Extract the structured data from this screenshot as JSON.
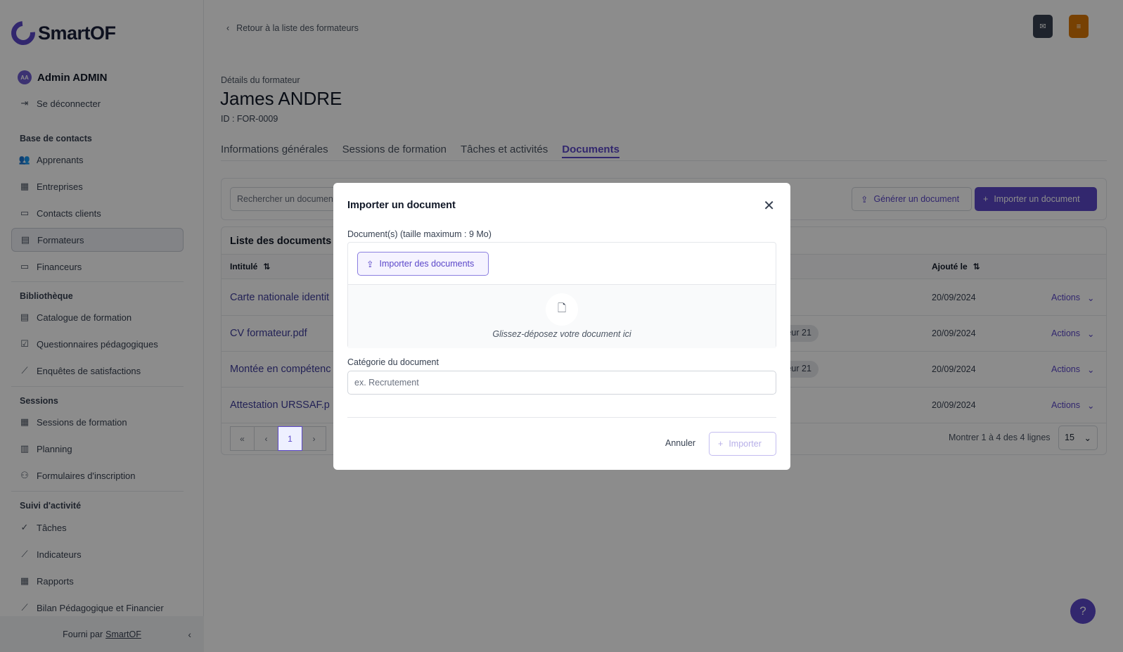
{
  "brand": {
    "name": "SmartOF"
  },
  "user": {
    "initials": "AA",
    "name": "Admin ADMIN",
    "logout": "Se déconnecter"
  },
  "sidebar": {
    "sections": [
      {
        "title": "Base de contacts",
        "items": [
          "Apprenants",
          "Entreprises",
          "Contacts clients",
          "Formateurs",
          "Financeurs"
        ]
      },
      {
        "title": "Bibliothèque",
        "items": [
          "Catalogue de formation",
          "Questionnaires pédagogiques",
          "Enquêtes de satisfactions"
        ]
      },
      {
        "title": "Sessions",
        "items": [
          "Sessions de formation",
          "Planning",
          "Formulaires d'inscription"
        ]
      },
      {
        "title": "Suivi d'activité",
        "items": [
          "Tâches",
          "Indicateurs",
          "Rapports",
          "Bilan Pédagogique et Financier"
        ]
      }
    ],
    "footer": {
      "prefix": "Fourni par",
      "link": "SmartOF"
    }
  },
  "header": {
    "back": "Retour à la liste des formateurs",
    "subtitle": "Détails du formateur",
    "title": "James ANDRE",
    "id": "ID : FOR-0009"
  },
  "tabs": [
    "Informations générales",
    "Sessions de formation",
    "Tâches et activités",
    "Documents"
  ],
  "toolbar": {
    "search_placeholder": "Rechercher un documen",
    "generate": "Générer un document",
    "import": "Importer un document"
  },
  "table": {
    "title": "Liste des documents d",
    "columns": {
      "name": "Intitulé",
      "added": "Ajouté le"
    },
    "rows": [
      {
        "name": "Carte nationale identit",
        "badge": "",
        "date": "20/09/2024",
        "actions": "Actions"
      },
      {
        "name": "CV formateur.pdf",
        "badge": "teur 21",
        "date": "20/09/2024",
        "actions": "Actions"
      },
      {
        "name": "Montée en compétenc",
        "badge": "teur 21",
        "date": "20/09/2024",
        "actions": "Actions"
      },
      {
        "name": "Attestation URSSAF.p",
        "badge": "",
        "date": "20/09/2024",
        "actions": "Actions"
      }
    ],
    "pager": {
      "current": "1"
    },
    "page_info": "Montrer 1 à 4 des 4 lignes",
    "per_page": "15"
  },
  "modal": {
    "title": "Importer un document",
    "docs_label": "Document(s) (taille maximum : 9 Mo)",
    "upload_button": "Importer des documents",
    "drop_text": "Glissez-déposez votre document ici",
    "category_label": "Catégorie du document",
    "category_placeholder": "ex. Recrutement",
    "cancel": "Annuler",
    "submit": "Importer"
  },
  "help": "?",
  "colors": {
    "accent": "#5b47c9",
    "dark_button": "#374151",
    "orange_button": "#d97706"
  }
}
